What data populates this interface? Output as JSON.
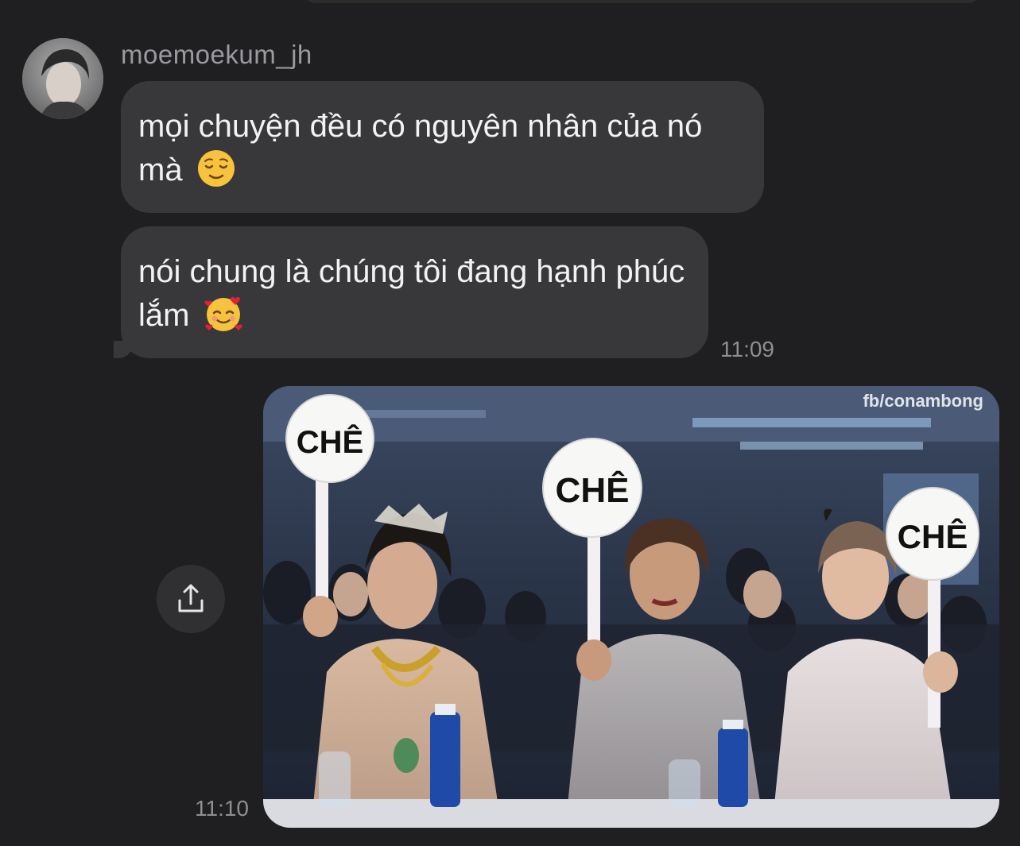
{
  "conversation": {
    "sender": {
      "username": "moemoekum_jh"
    },
    "messages": [
      {
        "type": "text",
        "text": "mọi chuyện đều có nguyên nhân của nó mà",
        "emoji": "relieved-face"
      },
      {
        "type": "text",
        "text": "nói chung là chúng tôi đang hạnh phúc lắm",
        "emoji": "smiling-face-with-hearts",
        "time": "11:09"
      },
      {
        "type": "image",
        "time": "11:10",
        "watermark": "fb/conambong",
        "sign_labels": [
          "CHÊ",
          "CHÊ",
          "CHÊ"
        ]
      }
    ]
  },
  "icons": {
    "share": "share-upload-icon"
  },
  "colors": {
    "background": "#1f1f21",
    "bubble": "#38383b",
    "text": "#f2f2f2",
    "meta": "#8e8e93"
  }
}
